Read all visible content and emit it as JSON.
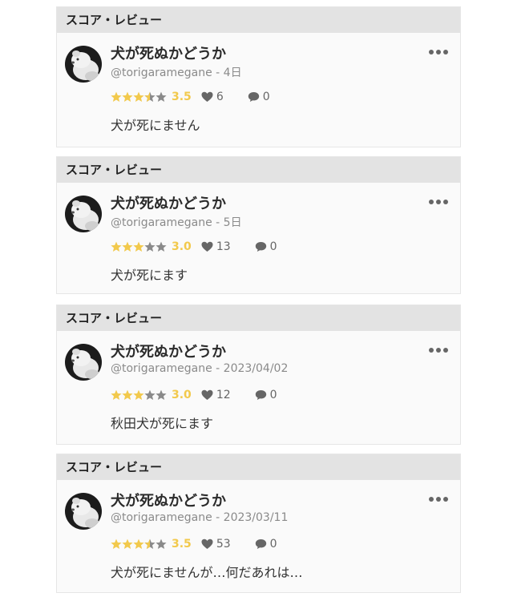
{
  "colors": {
    "header_bg": "#e3e3e3",
    "card_bg": "#fafafa",
    "star_filled": "#f2c94c",
    "star_empty": "#8a8a8a"
  },
  "reviews": [
    {
      "section_label": "スコア・レビュー",
      "title": "犬が死ぬかどうか",
      "author": "@torigaramegane",
      "separator": " - ",
      "date": "4日",
      "rating": 3.5,
      "score_label": "3.5",
      "likes": "6",
      "comments": "0",
      "text": "犬が死にません"
    },
    {
      "section_label": "スコア・レビュー",
      "title": "犬が死ぬかどうか",
      "author": "@torigaramegane",
      "separator": " - ",
      "date": "5日",
      "rating": 3.0,
      "score_label": "3.0",
      "likes": "13",
      "comments": "0",
      "text": "犬が死にます"
    },
    {
      "section_label": "スコア・レビュー",
      "title": "犬が死ぬかどうか",
      "author": "@torigaramegane",
      "separator": " - ",
      "date": "2023/04/02",
      "rating": 3.0,
      "score_label": "3.0",
      "likes": "12",
      "comments": "0",
      "text": "秋田犬が死にます"
    },
    {
      "section_label": "スコア・レビュー",
      "title": "犬が死ぬかどうか",
      "author": "@torigaramegane",
      "separator": " - ",
      "date": "2023/03/11",
      "rating": 3.5,
      "score_label": "3.5",
      "likes": "53",
      "comments": "0",
      "text": "犬が死にませんが…何だあれは…"
    }
  ]
}
